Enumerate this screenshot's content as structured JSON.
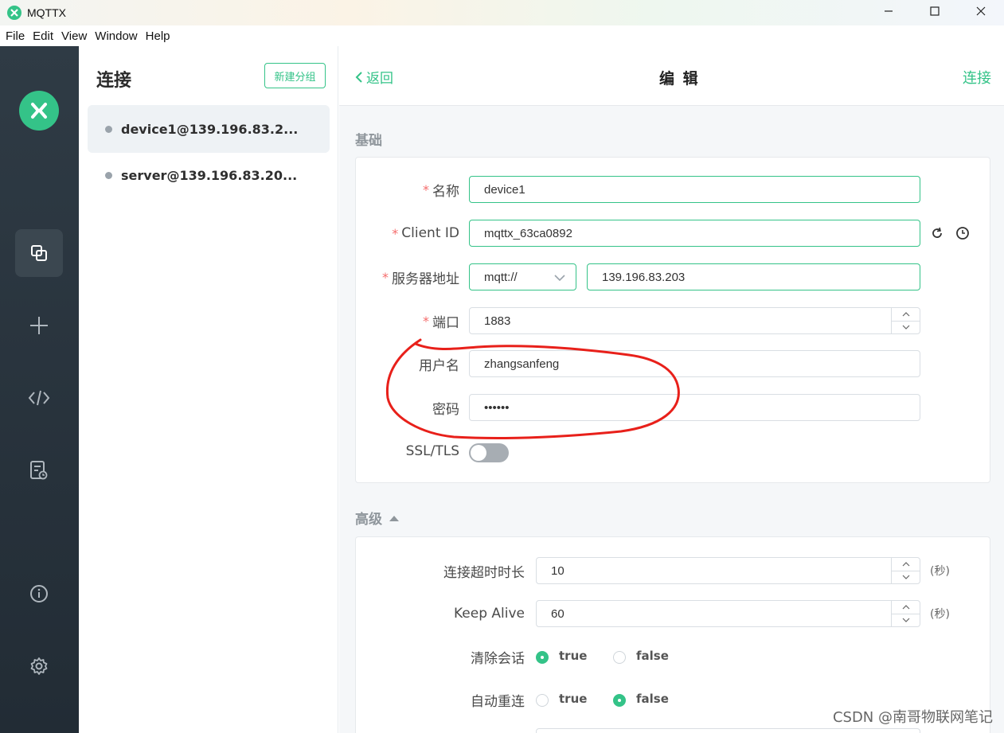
{
  "window": {
    "title": "MQTTX"
  },
  "menu": {
    "items": [
      "File",
      "Edit",
      "View",
      "Window",
      "Help"
    ]
  },
  "rail": {
    "icons": [
      "connections-icon",
      "add-icon",
      "script-icon",
      "log-icon",
      "about-icon",
      "settings-icon"
    ]
  },
  "connections": {
    "title": "连接",
    "new_group_label": "新建分组",
    "items": [
      {
        "name": "device1@139.196.83.2...",
        "selected": true
      },
      {
        "name": "server@139.196.83.20..."
      }
    ]
  },
  "header": {
    "back_label": "返回",
    "title": "编 辑",
    "connect_label": "连接"
  },
  "basic": {
    "section_title": "基础",
    "name": {
      "label": "名称",
      "value": "device1"
    },
    "client_id": {
      "label": "Client ID",
      "value": "mqttx_63ca0892"
    },
    "host": {
      "label": "服务器地址",
      "protocol": "mqtt://",
      "value": "139.196.83.203"
    },
    "port": {
      "label": "端口",
      "value": "1883"
    },
    "username": {
      "label": "用户名",
      "value": "zhangsanfeng"
    },
    "password": {
      "label": "密码",
      "value": "••••••"
    },
    "ssl": {
      "label": "SSL/TLS",
      "enabled": false
    }
  },
  "advanced": {
    "section_title": "高级",
    "timeout": {
      "label": "连接超时时长",
      "value": "10",
      "unit": "(秒)"
    },
    "keepalive": {
      "label": "Keep Alive",
      "value": "60",
      "unit": "(秒)"
    },
    "clean_session": {
      "label": "清除会话",
      "true_label": "true",
      "false_label": "false",
      "selected": "true"
    },
    "auto_reconnect": {
      "label": "自动重连",
      "true_label": "true",
      "false_label": "false",
      "selected": "false"
    }
  },
  "watermark": "CSDN @南哥物联网笔记",
  "colors": {
    "accent": "#34c388",
    "rail": "#2a353f",
    "required": "#f56c6c",
    "annotation": "#e8201a"
  }
}
